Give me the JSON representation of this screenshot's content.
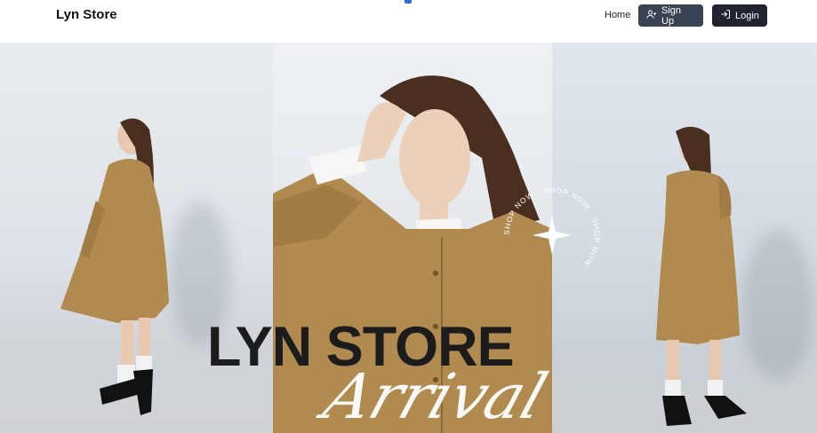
{
  "brand": "Lyn Store",
  "nav": {
    "home": "Home",
    "signup": "Sign Up",
    "login": "Login"
  },
  "hero": {
    "headline": "LYN STORE",
    "script_text": "Arrival",
    "badge_text": "SHOP NOW · SHOP NOW · SHOP NOW ·"
  },
  "colors": {
    "button_dark": "#1f2430",
    "button_signup": "#3a4353",
    "coat": "#b08a4f",
    "headline": "#1c1c1c"
  },
  "icons": {
    "signup": "user-plus-icon",
    "login": "login-arrow-icon"
  }
}
